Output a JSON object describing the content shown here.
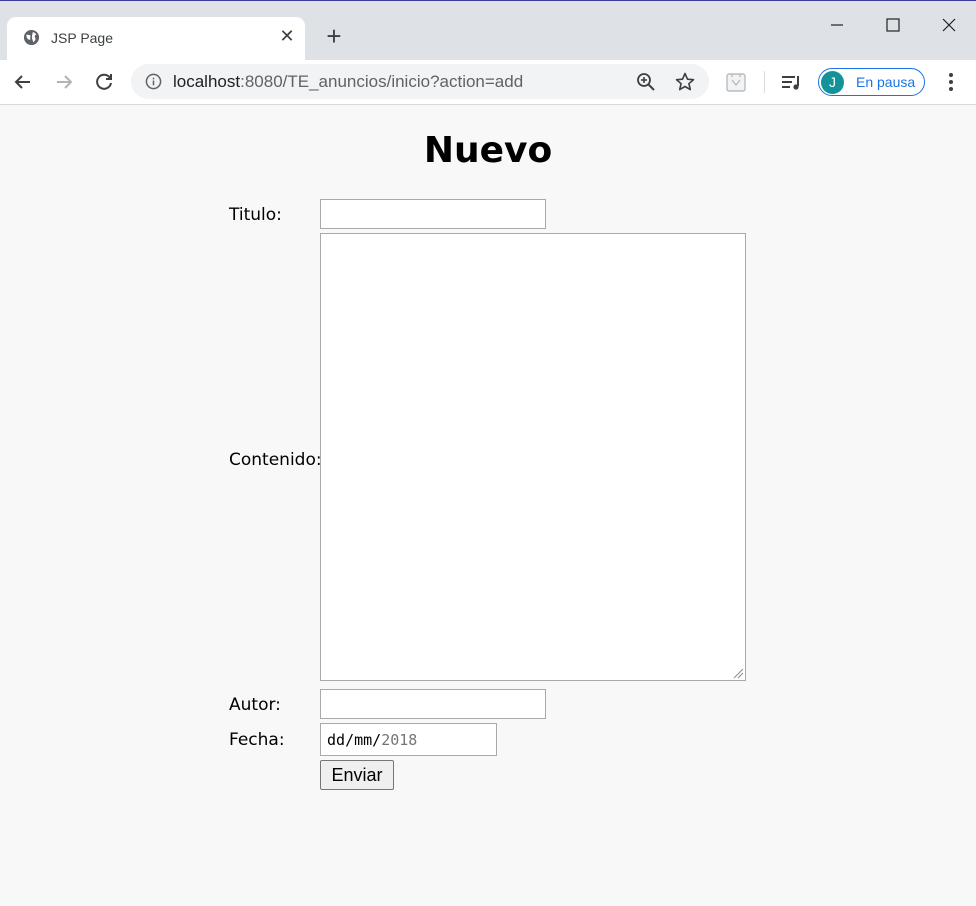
{
  "browser": {
    "tab": {
      "title": "JSP Page",
      "favicon": "globe-icon"
    },
    "address_bar": {
      "url_host": "localhost",
      "url_rest": ":8080/TE_anuncios/inicio?action=add"
    },
    "profile": {
      "initial": "J",
      "label": "En pausa",
      "color": "#12939a"
    },
    "icons": [
      "back-arrow-icon",
      "forward-arrow-icon",
      "reload-icon",
      "info-icon",
      "zoom-icon",
      "star-icon",
      "extension-icon",
      "media-queue-icon",
      "more-vert-icon",
      "minimize-icon",
      "maximize-icon",
      "close-icon",
      "new-tab-icon"
    ]
  },
  "page": {
    "heading": "Nuevo",
    "form": {
      "titulo_label": "Titulo:",
      "titulo_value": "",
      "contenido_label": "Contenido:",
      "contenido_value": "",
      "autor_label": "Autor:",
      "autor_value": "",
      "fecha_label": "Fecha:",
      "fecha_day": "dd",
      "fecha_sep1": "/",
      "fecha_month": "mm",
      "fecha_sep2": "/",
      "fecha_year": "2018",
      "submit_label": "Enviar"
    }
  }
}
